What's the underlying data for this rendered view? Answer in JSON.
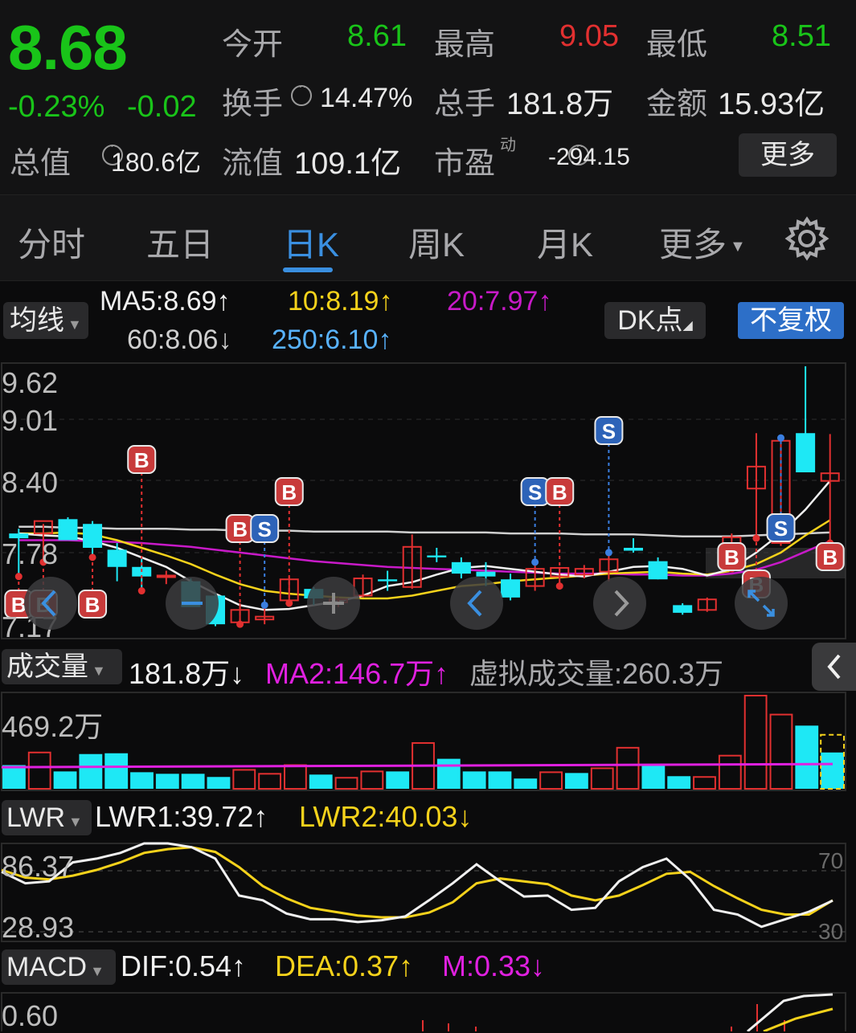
{
  "quote": {
    "price": "8.68",
    "change_pct": "-0.23%",
    "change_amt": "-0.02",
    "open_label": "今开",
    "open_value": "8.61",
    "high_label": "最高",
    "high_value": "9.05",
    "low_label": "最低",
    "low_value": "8.51",
    "turnover_label": "换手",
    "turnover_value": "14.47%",
    "volume_label": "总手",
    "volume_value": "181.8万",
    "amount_label": "金额",
    "amount_value": "15.93亿",
    "mktcap_label": "总值",
    "mktcap_value": "180.6亿",
    "float_label": "流值",
    "float_value": "109.1亿",
    "pe_label": "市盈",
    "pe_sup": "动",
    "pe_value": "-294.15",
    "more_label": "更多"
  },
  "tabs": {
    "items": [
      "分时",
      "五日",
      "日K",
      "周K",
      "月K",
      "更多"
    ],
    "active_index": 2,
    "settings_icon": "gear-icon"
  },
  "ma": {
    "selector_label": "均线",
    "ma5": "MA5:8.69↑",
    "ma10": "10:8.19↑",
    "ma20": "20:7.97↑",
    "ma60": "60:8.06↓",
    "ma250": "250:6.10↑",
    "dk_label": "DK点",
    "adjust_label": "不复权",
    "colors": {
      "ma5": "#f0f0f0",
      "ma10": "#f5d21b",
      "ma20": "#c81ac8",
      "ma60": "#cfcfcf",
      "ma250": "#58b2ff"
    }
  },
  "kline": {
    "y_ticks": [
      "9.62",
      "9.01",
      "8.40",
      "7.78",
      "7.17"
    ],
    "up_color": "#e23030",
    "down_color": "#1ee8f5",
    "candles": [
      {
        "o": 8.05,
        "h": 8.1,
        "l": 7.6,
        "c": 8.0
      },
      {
        "o": 8.05,
        "h": 8.15,
        "l": 7.75,
        "c": 8.18
      },
      {
        "o": 8.2,
        "h": 8.22,
        "l": 8.0,
        "c": 7.98
      },
      {
        "o": 8.15,
        "h": 8.18,
        "l": 7.8,
        "c": 7.9
      },
      {
        "o": 7.88,
        "h": 7.95,
        "l": 7.55,
        "c": 7.7
      },
      {
        "o": 7.7,
        "h": 7.8,
        "l": 7.45,
        "c": 7.6
      },
      {
        "o": 7.6,
        "h": 7.66,
        "l": 7.52,
        "c": 7.61
      },
      {
        "o": 7.55,
        "h": 7.58,
        "l": 7.3,
        "c": 7.28
      },
      {
        "o": 7.4,
        "h": 7.42,
        "l": 7.08,
        "c": 7.1
      },
      {
        "o": 7.12,
        "h": 7.32,
        "l": 7.1,
        "c": 7.25
      },
      {
        "o": 7.15,
        "h": 7.3,
        "l": 7.1,
        "c": 7.18
      },
      {
        "o": 7.35,
        "h": 7.6,
        "l": 7.32,
        "c": 7.57
      },
      {
        "o": 7.47,
        "h": 7.49,
        "l": 7.3,
        "c": 7.37
      },
      {
        "o": 7.33,
        "h": 7.38,
        "l": 7.28,
        "c": 7.36
      },
      {
        "o": 7.4,
        "h": 7.62,
        "l": 7.38,
        "c": 7.58
      },
      {
        "o": 7.57,
        "h": 7.66,
        "l": 7.45,
        "c": 7.55
      },
      {
        "o": 7.49,
        "h": 8.04,
        "l": 7.47,
        "c": 7.91
      },
      {
        "o": 7.82,
        "h": 7.9,
        "l": 7.75,
        "c": 7.8
      },
      {
        "o": 7.75,
        "h": 7.8,
        "l": 7.58,
        "c": 7.63
      },
      {
        "o": 7.65,
        "h": 7.75,
        "l": 7.5,
        "c": 7.6
      },
      {
        "o": 7.57,
        "h": 7.63,
        "l": 7.35,
        "c": 7.38
      },
      {
        "o": 7.5,
        "h": 7.75,
        "l": 7.45,
        "c": 7.68
      },
      {
        "o": 7.6,
        "h": 7.7,
        "l": 7.5,
        "c": 7.69
      },
      {
        "o": 7.62,
        "h": 7.72,
        "l": 7.58,
        "c": 7.68
      },
      {
        "o": 7.65,
        "h": 7.85,
        "l": 7.55,
        "c": 7.78
      },
      {
        "o": 7.9,
        "h": 8.0,
        "l": 7.85,
        "c": 7.87
      },
      {
        "o": 7.76,
        "h": 7.8,
        "l": 7.57,
        "c": 7.57
      },
      {
        "o": 7.3,
        "h": 7.32,
        "l": 7.2,
        "c": 7.22
      },
      {
        "o": 7.25,
        "h": 7.38,
        "l": 7.23,
        "c": 7.36
      },
      {
        "o": 7.7,
        "h": 8.05,
        "l": 7.68,
        "c": 8.01
      },
      {
        "o": 8.52,
        "h": 9.1,
        "l": 8.0,
        "c": 8.75
      },
      {
        "o": 7.95,
        "h": 9.05,
        "l": 7.92,
        "c": 9.02
      },
      {
        "o": 9.1,
        "h": 9.8,
        "l": 8.7,
        "c": 8.69
      },
      {
        "o": 8.6,
        "h": 9.09,
        "l": 7.95,
        "c": 8.68
      }
    ],
    "ma5": [
      8.05,
      8.03,
      8.02,
      7.97,
      7.9,
      7.8,
      7.7,
      7.55,
      7.42,
      7.3,
      7.25,
      7.26,
      7.3,
      7.34,
      7.4,
      7.5,
      7.54,
      7.62,
      7.69,
      7.71,
      7.68,
      7.65,
      7.62,
      7.6,
      7.65,
      7.7,
      7.71,
      7.68,
      7.61,
      7.68,
      7.85,
      8.05,
      8.3,
      8.6
    ],
    "ma10": [
      8.05,
      8.05,
      8.06,
      8.04,
      7.98,
      7.9,
      7.82,
      7.73,
      7.62,
      7.52,
      7.45,
      7.42,
      7.4,
      7.38,
      7.37,
      7.37,
      7.4,
      7.45,
      7.5,
      7.52,
      7.55,
      7.57,
      7.59,
      7.61,
      7.63,
      7.64,
      7.65,
      7.63,
      7.62,
      7.66,
      7.73,
      7.85,
      8.03,
      8.19
    ],
    "ma20": [
      7.98,
      7.98,
      7.98,
      7.97,
      7.96,
      7.95,
      7.93,
      7.91,
      7.88,
      7.85,
      7.82,
      7.79,
      7.76,
      7.74,
      7.72,
      7.7,
      7.69,
      7.68,
      7.67,
      7.66,
      7.65,
      7.64,
      7.63,
      7.63,
      7.63,
      7.62,
      7.62,
      7.61,
      7.61,
      7.63,
      7.67,
      7.75,
      7.86,
      7.97
    ],
    "ma60": [
      8.12,
      8.12,
      8.11,
      8.11,
      8.1,
      8.1,
      8.1,
      8.09,
      8.09,
      8.08,
      8.08,
      8.08,
      8.07,
      8.07,
      8.07,
      8.07,
      8.06,
      8.06,
      8.06,
      8.06,
      8.05,
      8.05,
      8.05,
      8.04,
      8.04,
      8.04,
      8.03,
      8.02,
      8.02,
      8.02,
      8.03,
      8.04,
      8.05,
      8.06
    ],
    "dk_markers": [
      {
        "i": 0,
        "t": "B",
        "row": "low"
      },
      {
        "i": 1,
        "t": "B",
        "row": "low"
      },
      {
        "i": 3,
        "t": "B",
        "row": "low"
      },
      {
        "i": 5,
        "t": "B",
        "row": "high"
      },
      {
        "i": 9,
        "t": "B",
        "row": "mid"
      },
      {
        "i": 10,
        "t": "S",
        "row": "mid"
      },
      {
        "i": 11,
        "t": "B",
        "row": "high2"
      },
      {
        "i": 21,
        "t": "S",
        "row": "high2"
      },
      {
        "i": 22,
        "t": "B",
        "row": "high2"
      },
      {
        "i": 24,
        "t": "S",
        "row": "top"
      },
      {
        "i": 29,
        "t": "B",
        "row": "mid2"
      },
      {
        "i": 30,
        "t": "B",
        "row": "low2"
      },
      {
        "i": 31,
        "t": "S",
        "row": "mid3"
      },
      {
        "i": 33,
        "t": "B",
        "row": "mid2"
      }
    ]
  },
  "volume": {
    "selector_label": "成交量",
    "current": "181.8万↓",
    "ma2": "MA2:146.7万↑",
    "virtual": "虚拟成交量:260.3万",
    "y_top": "469.2万",
    "bars": [
      {
        "v": 150,
        "up": false
      },
      {
        "v": 230,
        "up": true
      },
      {
        "v": 110,
        "up": false
      },
      {
        "v": 220,
        "up": false
      },
      {
        "v": 225,
        "up": false
      },
      {
        "v": 105,
        "up": false
      },
      {
        "v": 95,
        "up": false
      },
      {
        "v": 95,
        "up": false
      },
      {
        "v": 75,
        "up": false
      },
      {
        "v": 120,
        "up": true
      },
      {
        "v": 95,
        "up": true
      },
      {
        "v": 150,
        "up": true
      },
      {
        "v": 90,
        "up": false
      },
      {
        "v": 70,
        "up": true
      },
      {
        "v": 110,
        "up": true
      },
      {
        "v": 110,
        "up": false
      },
      {
        "v": 290,
        "up": true
      },
      {
        "v": 190,
        "up": false
      },
      {
        "v": 110,
        "up": false
      },
      {
        "v": 110,
        "up": false
      },
      {
        "v": 65,
        "up": false
      },
      {
        "v": 105,
        "up": true
      },
      {
        "v": 100,
        "up": false
      },
      {
        "v": 130,
        "up": true
      },
      {
        "v": 260,
        "up": true
      },
      {
        "v": 150,
        "up": false
      },
      {
        "v": 80,
        "up": false
      },
      {
        "v": 75,
        "up": true
      },
      {
        "v": 210,
        "up": true
      },
      {
        "v": 590,
        "up": true
      },
      {
        "v": 470,
        "up": true
      },
      {
        "v": 400,
        "up": false
      },
      {
        "v": 230,
        "up": false,
        "virtual": true
      }
    ],
    "ma_line": 146.7,
    "colors": {
      "ma": "#e020e0"
    }
  },
  "lwr": {
    "selector_label": "LWR",
    "lwr1": "LWR1:39.72↑",
    "lwr2": "LWR2:40.03↓",
    "y_labels": [
      "86.37",
      "28.93"
    ],
    "right_labels": [
      "70",
      "30"
    ],
    "lwr1_series": [
      70,
      58,
      60,
      80,
      84,
      90,
      100,
      100,
      96,
      84,
      45,
      40,
      26,
      20,
      20,
      17,
      19,
      23,
      40,
      58,
      78,
      60,
      44,
      45,
      30,
      32,
      60,
      75,
      84,
      62,
      30,
      25,
      12,
      20,
      28,
      39.72
    ],
    "lwr2_series": [
      72,
      64,
      62,
      66,
      72,
      80,
      90,
      94,
      96,
      91,
      75,
      55,
      42,
      32,
      28,
      24,
      22,
      22,
      27,
      38,
      58,
      63,
      60,
      57,
      45,
      40,
      45,
      56,
      68,
      70,
      55,
      42,
      30,
      25,
      25,
      40.03
    ]
  },
  "macd": {
    "selector_label": "MACD",
    "dif": "DIF:0.54↑",
    "dea": "DEA:0.37↑",
    "m": "M:0.33↓",
    "y_top": "0.60"
  },
  "nav": {
    "left_arrow": "chevron-left-icon",
    "right_arrow": "chevron-right-icon",
    "plus": "plus-icon",
    "expand": "expand-icon",
    "panel_toggle": "chevron-left-icon"
  }
}
